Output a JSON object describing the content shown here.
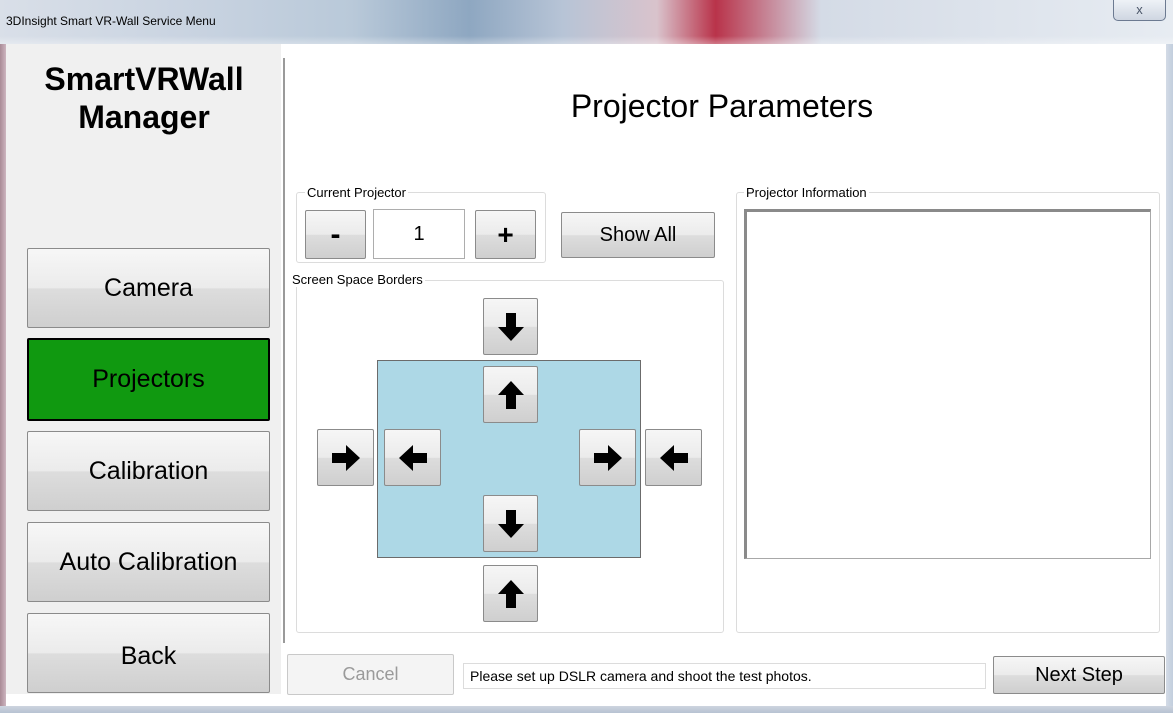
{
  "window": {
    "title": "3DInsight Smart VR-Wall Service Menu",
    "close_glyph": "x"
  },
  "sidebar": {
    "app_title_line1": "SmartVRWall",
    "app_title_line2": "Manager",
    "items": [
      {
        "label": "Camera",
        "active": false
      },
      {
        "label": "Projectors",
        "active": true
      },
      {
        "label": "Calibration",
        "active": false
      },
      {
        "label": "Auto Calibration",
        "active": false
      },
      {
        "label": "Back",
        "active": false
      }
    ],
    "active_color": "#109910"
  },
  "main": {
    "title": "Projector Parameters",
    "current_projector": {
      "group_label": "Current Projector",
      "minus_label": "-",
      "value": "1",
      "plus_label": "+",
      "show_all_label": "Show All"
    },
    "screen_space": {
      "group_label": "Screen Space Borders",
      "fill_color": "#add8e6",
      "arrows": {
        "top_outer": "down-arrow-icon",
        "top_inner": "up-arrow-icon",
        "left_outer": "right-arrow-icon",
        "left_inner": "left-arrow-icon",
        "right_inner": "right-arrow-icon",
        "right_outer": "left-arrow-icon",
        "bottom_inner": "down-arrow-icon",
        "bottom_outer": "up-arrow-icon"
      }
    },
    "projector_info": {
      "group_label": "Projector Information",
      "content": ""
    }
  },
  "footer": {
    "cancel_label": "Cancel",
    "status_text": "Please set up DSLR camera and shoot the test photos.",
    "next_label": "Next Step"
  }
}
